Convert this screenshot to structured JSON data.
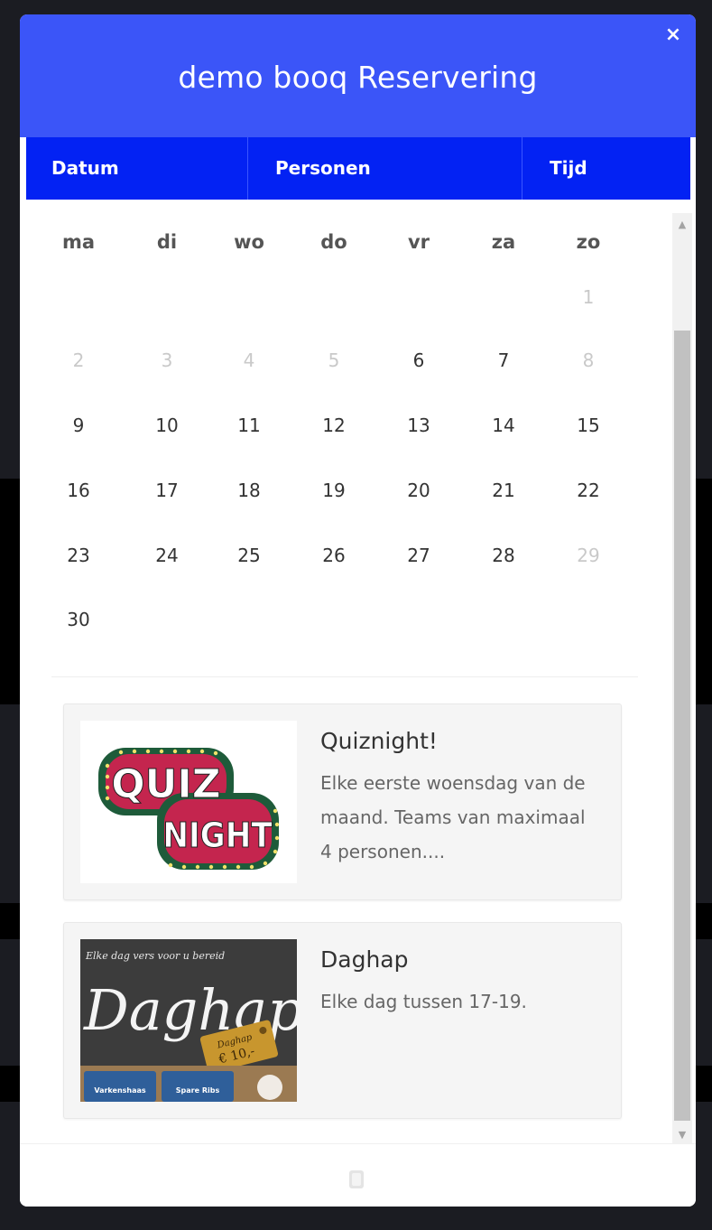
{
  "modal": {
    "title": "demo booq Reservering",
    "close_label": "×"
  },
  "tabs": [
    {
      "label": "Datum"
    },
    {
      "label": "Personen"
    },
    {
      "label": "Tijd"
    }
  ],
  "calendar": {
    "weekdays": [
      "ma",
      "di",
      "wo",
      "do",
      "vr",
      "za",
      "zo"
    ],
    "weeks": [
      [
        null,
        null,
        null,
        null,
        null,
        null,
        {
          "day": "1",
          "enabled": false
        }
      ],
      [
        {
          "day": "2",
          "enabled": false
        },
        {
          "day": "3",
          "enabled": false
        },
        {
          "day": "4",
          "enabled": false
        },
        {
          "day": "5",
          "enabled": false
        },
        {
          "day": "6",
          "enabled": true
        },
        {
          "day": "7",
          "enabled": true
        },
        {
          "day": "8",
          "enabled": false
        }
      ],
      [
        {
          "day": "9",
          "enabled": true
        },
        {
          "day": "10",
          "enabled": true
        },
        {
          "day": "11",
          "enabled": true
        },
        {
          "day": "12",
          "enabled": true
        },
        {
          "day": "13",
          "enabled": true
        },
        {
          "day": "14",
          "enabled": true
        },
        {
          "day": "15",
          "enabled": true
        }
      ],
      [
        {
          "day": "16",
          "enabled": true
        },
        {
          "day": "17",
          "enabled": true
        },
        {
          "day": "18",
          "enabled": true
        },
        {
          "day": "19",
          "enabled": true
        },
        {
          "day": "20",
          "enabled": true
        },
        {
          "day": "21",
          "enabled": true
        },
        {
          "day": "22",
          "enabled": true
        }
      ],
      [
        {
          "day": "23",
          "enabled": true
        },
        {
          "day": "24",
          "enabled": true
        },
        {
          "day": "25",
          "enabled": true
        },
        {
          "day": "26",
          "enabled": true
        },
        {
          "day": "27",
          "enabled": true
        },
        {
          "day": "28",
          "enabled": true
        },
        {
          "day": "29",
          "enabled": false
        }
      ],
      [
        {
          "day": "30",
          "enabled": true
        },
        null,
        null,
        null,
        null,
        null,
        null
      ]
    ]
  },
  "events": [
    {
      "title": "Quiznight!",
      "description": "Elke eerste woensdag van de maand. Teams van maximaal 4 personen....",
      "image_icon": "quiz-night-logo",
      "image_text_top": "QUIZ",
      "image_text_bottom": "NIGHT"
    },
    {
      "title": "Daghap",
      "description": "Elke dag tussen 17-19.",
      "image_icon": "daghap-chalkboard-image",
      "image_caption": "Elke dag vers voor u bereid",
      "image_big_text": "Daghap",
      "image_tag_text": "Daghap",
      "image_price": "€ 10,-",
      "image_panel_left": "Varkenshaas",
      "image_panel_right": "Spare Ribs"
    }
  ],
  "colors": {
    "header": "#3b55f8",
    "tabs": "#0322f3",
    "disabled_day": "#c9c9c9"
  }
}
